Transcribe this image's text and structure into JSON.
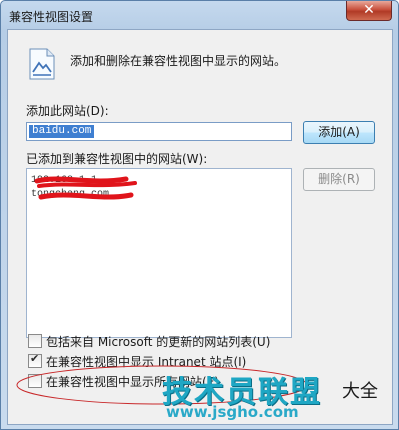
{
  "window": {
    "title": "兼容性视图设置",
    "close_glyph": "✕"
  },
  "header": {
    "text": "添加和删除在兼容性视图中显示的网站。"
  },
  "add_section": {
    "label": "添加此网站(D):",
    "input_value": "baidu.com",
    "add_button": "添加(A)"
  },
  "list_section": {
    "label": "已添加到兼容性视图中的网站(W):",
    "items": [
      "192.168.1.1",
      "tongcheng.com"
    ],
    "remove_button": "删除(R)"
  },
  "options": [
    {
      "label": "包括来自 Microsoft 的更新的网站列表(U)",
      "checked": false
    },
    {
      "label": "在兼容性视图中显示 Intranet 站点(I)",
      "checked": true
    },
    {
      "label": "在兼容性视图中显示所有网站(E)",
      "checked": false
    }
  ],
  "watermark": {
    "brand": "技术员联盟",
    "url": "www.jsgho.com",
    "suffix": "大全"
  }
}
